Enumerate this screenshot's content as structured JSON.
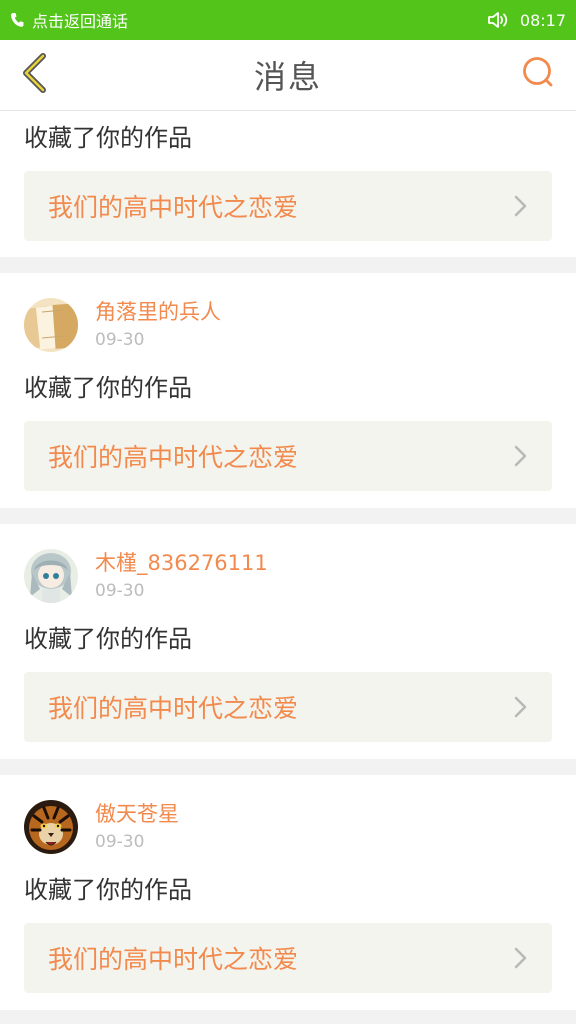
{
  "statusbar": {
    "call_text": "点击返回通话",
    "time": "08:17",
    "bg_color": "#52c41a"
  },
  "header": {
    "title": "消息",
    "accent_color": "#f28a4e"
  },
  "messages": [
    {
      "username": "",
      "date": "",
      "action": "收藏了你的作品",
      "work_title": "我们的高中时代之恋爱"
    },
    {
      "username": "角落里的兵人",
      "date": "09-30",
      "action": "收藏了你的作品",
      "work_title": "我们的高中时代之恋爱",
      "avatar_icon": "books-avatar"
    },
    {
      "username": "木槿_836276111",
      "date": "09-30",
      "action": "收藏了你的作品",
      "work_title": "我们的高中时代之恋爱",
      "avatar_icon": "anime-girl-avatar"
    },
    {
      "username": "傲天苍星",
      "date": "09-30",
      "action": "收藏了你的作品",
      "work_title": "我们的高中时代之恋爱",
      "avatar_icon": "tiger-avatar"
    }
  ]
}
